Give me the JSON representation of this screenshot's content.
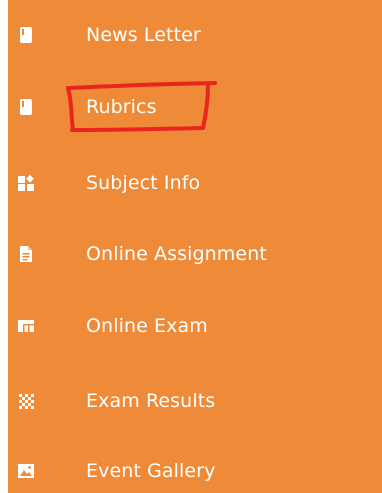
{
  "sidebar": {
    "background": "#ef8a38",
    "text_color": "#ffffff",
    "items": [
      {
        "label": "News Letter",
        "icon": "book-icon"
      },
      {
        "label": "Rubrics",
        "icon": "book-icon"
      },
      {
        "label": "Subject Info",
        "icon": "widgets-icon"
      },
      {
        "label": "Online Assignment",
        "icon": "document-icon"
      },
      {
        "label": "Online Exam",
        "icon": "dashboard-icon"
      },
      {
        "label": "Exam Results",
        "icon": "grid-dots-icon"
      },
      {
        "label": "Event Gallery",
        "icon": "image-icon"
      }
    ]
  },
  "annotation": {
    "color": "#e8251f",
    "target": "Rubrics"
  }
}
